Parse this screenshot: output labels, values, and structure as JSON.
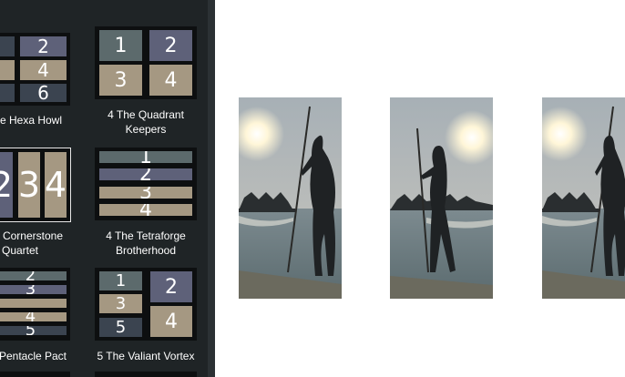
{
  "layouts": [
    {
      "id": "hexa",
      "label_line1": "e Hexa Howl",
      "label_line2": "",
      "cells": [
        "2",
        "4",
        "6"
      ]
    },
    {
      "id": "quadrant",
      "label_line1": "4 The Quadrant",
      "label_line2": "Keepers",
      "cells": [
        "1",
        "2",
        "3",
        "4"
      ]
    },
    {
      "id": "cornerstone",
      "label_line1": "Cornerstone",
      "label_line2": "Quartet",
      "cells": [
        "2",
        "3",
        "4"
      ]
    },
    {
      "id": "tetraforge",
      "label_line1": "4 The Tetraforge",
      "label_line2": "Brotherhood",
      "cells": [
        "1",
        "2",
        "3",
        "4"
      ]
    },
    {
      "id": "pentacle",
      "label_line1": "Pentacle Pact",
      "label_line2": "",
      "cells": [
        "2",
        "3",
        "4",
        "5"
      ]
    },
    {
      "id": "valiant",
      "label_line1": "5 The Valiant Vortex",
      "label_line2": "",
      "cells": [
        "1",
        "2",
        "3",
        "4",
        "5"
      ]
    }
  ],
  "selected_layout": "cornerstone",
  "colors": {
    "sidebar_bg": "#1f2426",
    "slate": "#5c6a6c",
    "violet": "#5e6179",
    "tan": "#a59882",
    "dark": "#3b4450"
  },
  "preview_frames": [
    {
      "id": "frame-1",
      "content": "photo-silhouette-paddleboard"
    },
    {
      "id": "frame-2",
      "content": "photo-silhouette-paddleboard"
    },
    {
      "id": "frame-3",
      "content": "photo-silhouette-paddleboard"
    }
  ]
}
